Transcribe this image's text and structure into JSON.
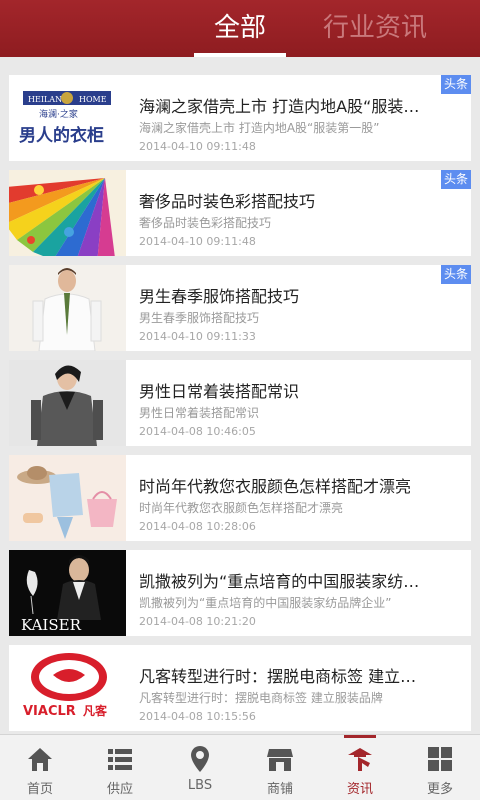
{
  "top_tabs": {
    "all": "全部",
    "industry": "行业资讯"
  },
  "colors": {
    "brand": "#a3262b",
    "badge": "#5d8df0"
  },
  "articles": [
    {
      "title": "海澜之家借壳上市 打造内地A股“服装第一股”",
      "summary": "海澜之家借壳上市 打造内地A股“服装第一股”",
      "time": "2014-04-10 09:11:48",
      "badge": "头条",
      "thumb": {
        "logo_top": "HEILAN",
        "logo_bottom": "HOME",
        "cn_top": "海澜·之家",
        "cn_main": "男人的衣柜"
      }
    },
    {
      "title": "奢侈品时装色彩搭配技巧",
      "summary": "奢侈品时装色彩搭配技巧",
      "time": "2014-04-10 09:11:48",
      "badge": "头条",
      "thumb": {
        "kind": "color-fan"
      }
    },
    {
      "title": "男生春季服饰搭配技巧",
      "summary": "男生春季服饰搭配技巧",
      "time": "2014-04-10 09:11:33",
      "badge": "头条",
      "thumb": {
        "kind": "man-white-shirt"
      }
    },
    {
      "title": "男性日常着装搭配常识",
      "summary": "男性日常着装搭配常识",
      "time": "2014-04-08 10:46:05",
      "badge": "",
      "thumb": {
        "kind": "man-grey-jacket"
      }
    },
    {
      "title": "时尚年代教您衣服颜色怎样搭配才漂亮",
      "summary": "时尚年代教您衣服颜色怎样搭配才漂亮",
      "time": "2014-04-08 10:28:06",
      "badge": "",
      "thumb": {
        "kind": "outfit-flatlay"
      }
    },
    {
      "title": "凯撒被列为“重点培育的中国服装家纺品牌企业”",
      "summary": "凯撒被列为“重点培育的中国服装家纺品牌企业”",
      "time": "2014-04-08 10:21:20",
      "badge": "",
      "thumb": {
        "brand": "KAISER"
      }
    },
    {
      "title": "凡客转型进行时：摆脱电商标签 建立服装品牌",
      "summary": "凡客转型进行时：摆脱电商标签 建立服装品牌",
      "time": "2014-04-08 10:15:56",
      "badge": "",
      "thumb": {
        "brand": "VIACLR",
        "brand_cn": "凡客"
      }
    }
  ],
  "bottom_nav": [
    {
      "label": "首页",
      "icon": "home-icon"
    },
    {
      "label": "供应",
      "icon": "list-icon"
    },
    {
      "label": "LBS",
      "icon": "location-pin-icon"
    },
    {
      "label": "商铺",
      "icon": "store-icon"
    },
    {
      "label": "资讯",
      "icon": "news-icon",
      "active": true
    },
    {
      "label": "更多",
      "icon": "grid-icon"
    }
  ]
}
